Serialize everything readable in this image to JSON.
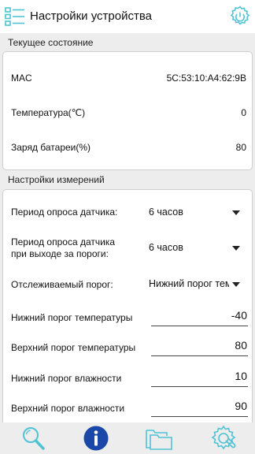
{
  "header": {
    "title": "Настройки устройства"
  },
  "status": {
    "section_title": "Текущее состояние",
    "mac_label": "MAC",
    "mac_value": "5C:53:10:A4:62:9B",
    "temp_label": "Температура(℃)",
    "temp_value": "0",
    "battery_label": "Заряд батареи(%)",
    "battery_value": "80"
  },
  "settings": {
    "section_title": "Настройки измерений",
    "poll_label": "Период опроса датчика:",
    "poll_value": "6 часов",
    "poll_threshold_label_line1": "Период опроса датчика",
    "poll_threshold_label_line2": "при выходе за пороги:",
    "poll_threshold_value": "6 часов",
    "tracked_label": "Отслеживаемый порог:",
    "tracked_value": "Нижний порог температуры",
    "temp_low_label": "Нижний порог температуры",
    "temp_low_value": "-40",
    "temp_high_label": "Верхний порог температуры",
    "temp_high_value": "80",
    "hum_low_label": "Нижний порог влажности",
    "hum_low_value": "10",
    "hum_high_label": "Верхний порог влажности",
    "hum_high_value": "90"
  },
  "colors": {
    "accent": "#4ec3d4",
    "info_blue": "#1a47a8"
  },
  "icons": [
    "list-menu-icon",
    "power-settings-icon",
    "search-icon",
    "info-icon",
    "folders-icon",
    "gear-settings-icon"
  ]
}
